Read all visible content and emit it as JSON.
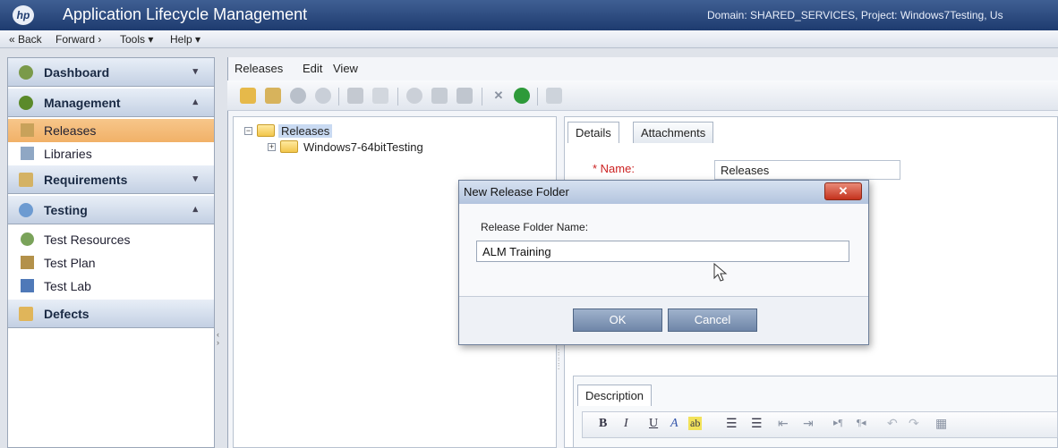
{
  "app": {
    "logo_text": "hp",
    "title": "Application Lifecycle Management",
    "context": "Domain: SHARED_SERVICES, Project: Windows7Testing, Us"
  },
  "top_menu": {
    "back": "« Back",
    "forward": "Forward ›",
    "tools": "Tools ▾",
    "help": "Help ▾"
  },
  "sidebar": {
    "dashboard": "Dashboard",
    "management": "Management",
    "releases": "Releases",
    "libraries": "Libraries",
    "requirements": "Requirements",
    "testing": "Testing",
    "test_resources": "Test Resources",
    "test_plan": "Test Plan",
    "test_lab": "Test Lab",
    "defects": "Defects"
  },
  "main_menu": {
    "releases": "Releases",
    "edit": "Edit",
    "view": "View"
  },
  "tree": {
    "root": "Releases",
    "child": "Windows7-64bitTesting"
  },
  "details": {
    "tabs": [
      "Details",
      "Attachments"
    ],
    "name_label": "* Name:",
    "name_value": "Releases",
    "description_tab": "Description"
  },
  "rich_toolbar": [
    "B",
    "I",
    "U",
    "A",
    "ab"
  ],
  "dialog": {
    "title": "New Release Folder",
    "close": "✕",
    "field_label": "Release Folder Name:",
    "field_value": "ALM Training",
    "ok": "OK",
    "cancel": "Cancel"
  },
  "colors": {
    "titlebar": "#1e3b6f",
    "selected_item": "#f1b168",
    "required_label": "#cc2222",
    "dialog_button": "#6f86a8",
    "close_button": "#c4321d"
  }
}
